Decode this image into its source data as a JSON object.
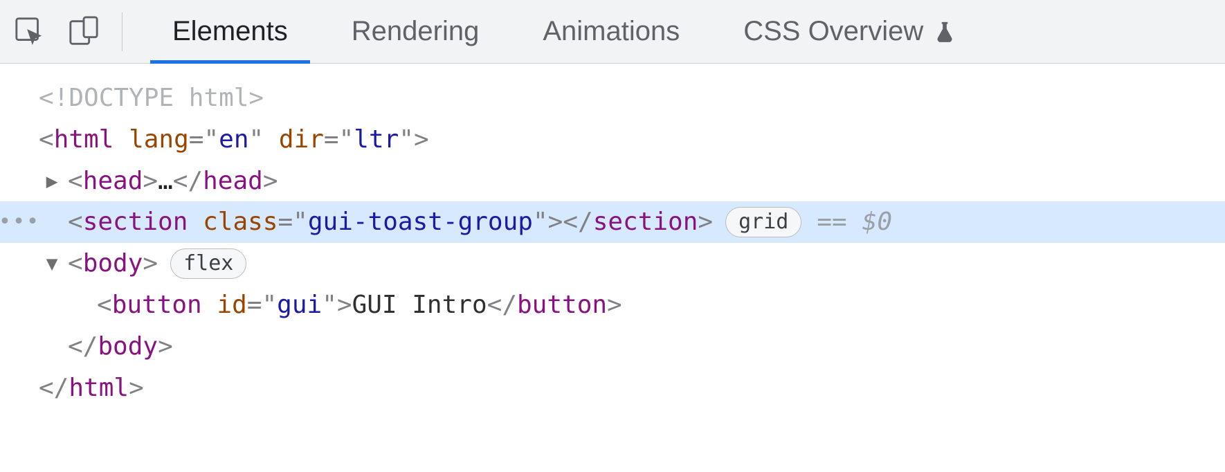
{
  "toolbar": {
    "tabs": [
      "Elements",
      "Rendering",
      "Animations",
      "CSS Overview"
    ],
    "active_tab_index": 0
  },
  "dom": {
    "doctype": "<!DOCTYPE html>",
    "html_open": {
      "tag": "html",
      "attrs": [
        {
          "name": "lang",
          "value": "en"
        },
        {
          "name": "dir",
          "value": "ltr"
        }
      ]
    },
    "head": {
      "tag": "head",
      "collapsed": true,
      "ellipsis": "…"
    },
    "section": {
      "tag": "section",
      "attrs": [
        {
          "name": "class",
          "value": "gui-toast-group"
        }
      ],
      "badge": "grid",
      "selected": true,
      "console_ref": "$0",
      "eq": "=="
    },
    "body": {
      "tag": "body",
      "badge": "flex",
      "expanded": true
    },
    "button": {
      "tag": "button",
      "attrs": [
        {
          "name": "id",
          "value": "gui"
        }
      ],
      "text": " GUI Intro "
    },
    "body_close": {
      "tag": "body"
    },
    "html_close": {
      "tag": "html"
    }
  }
}
